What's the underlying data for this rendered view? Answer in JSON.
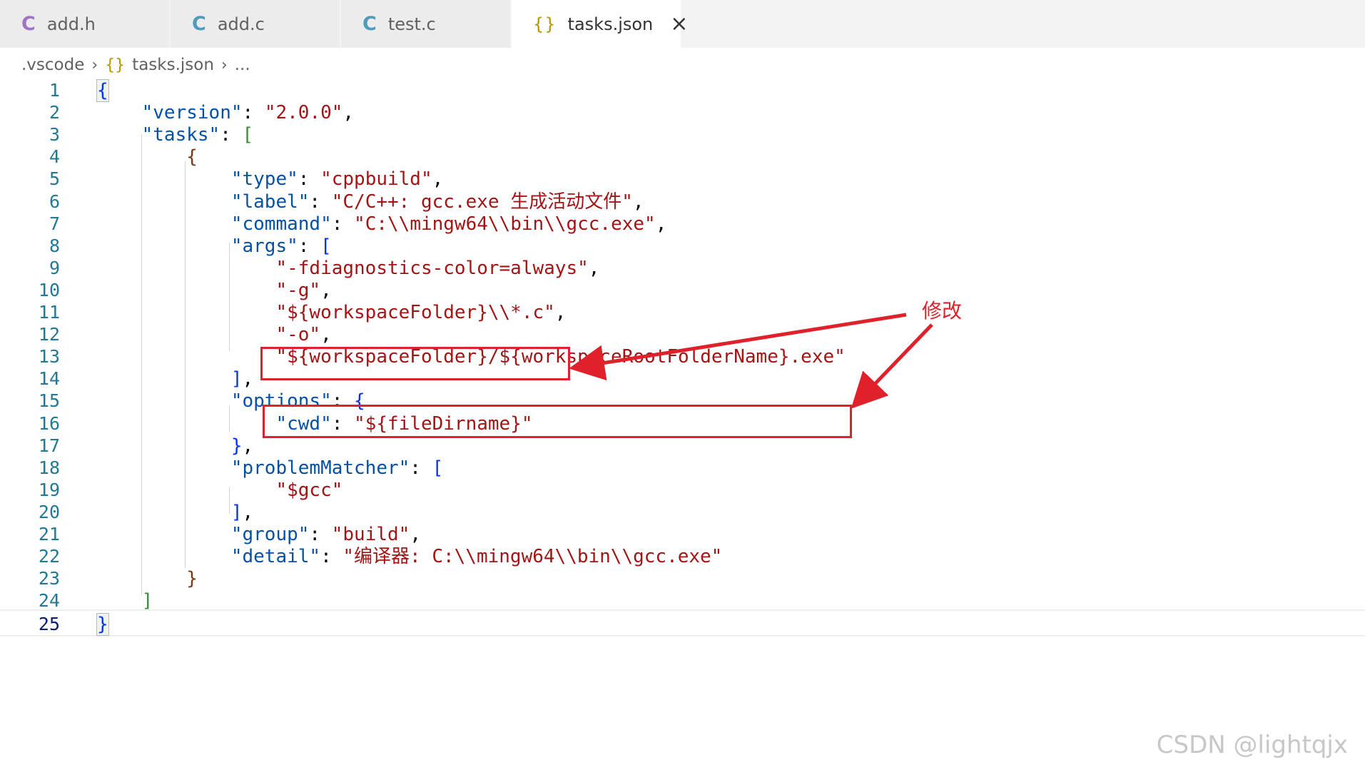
{
  "tabs": [
    {
      "label": "add.h",
      "icon": "C",
      "icon_color": "#a074c4"
    },
    {
      "label": "add.c",
      "icon": "C",
      "icon_color": "#519aba"
    },
    {
      "label": "test.c",
      "icon": "C",
      "icon_color": "#519aba"
    },
    {
      "label": "tasks.json",
      "icon": "{}",
      "icon_color": "#b89500",
      "active": true,
      "close": "×"
    }
  ],
  "breadcrumb": {
    "folder": ".vscode",
    "file_icon": "{}",
    "file": "tasks.json",
    "more": "..."
  },
  "editor": {
    "current_line": 25,
    "lines": [
      {
        "n": "1",
        "text": "{"
      },
      {
        "n": "2",
        "text": "    \"version\": \"2.0.0\","
      },
      {
        "n": "3",
        "text": "    \"tasks\": ["
      },
      {
        "n": "4",
        "text": "        {"
      },
      {
        "n": "5",
        "text": "            \"type\": \"cppbuild\","
      },
      {
        "n": "6",
        "text": "            \"label\": \"C/C++: gcc.exe 生成活动文件\","
      },
      {
        "n": "7",
        "text": "            \"command\": \"C:\\\\mingw64\\\\bin\\\\gcc.exe\","
      },
      {
        "n": "8",
        "text": "            \"args\": ["
      },
      {
        "n": "9",
        "text": "                \"-fdiagnostics-color=always\","
      },
      {
        "n": "10",
        "text": "                \"-g\","
      },
      {
        "n": "11",
        "text": "                \"${workspaceFolder}\\\\*.c\","
      },
      {
        "n": "12",
        "text": "                \"-o\","
      },
      {
        "n": "13",
        "text": "                \"${workspaceFolder}/${workspaceRootFolderName}.exe\""
      },
      {
        "n": "14",
        "text": "            ],"
      },
      {
        "n": "15",
        "text": "            \"options\": {"
      },
      {
        "n": "16",
        "text": "                \"cwd\": \"${fileDirname}\""
      },
      {
        "n": "17",
        "text": "            },"
      },
      {
        "n": "18",
        "text": "            \"problemMatcher\": ["
      },
      {
        "n": "19",
        "text": "                \"$gcc\""
      },
      {
        "n": "20",
        "text": "            ],"
      },
      {
        "n": "21",
        "text": "            \"group\": \"build\","
      },
      {
        "n": "22",
        "text": "            \"detail\": \"编译器: C:\\\\mingw64\\\\bin\\\\gcc.exe\""
      },
      {
        "n": "23",
        "text": "        }"
      },
      {
        "n": "24",
        "text": "    ]"
      },
      {
        "n": "25",
        "text": "}"
      }
    ]
  },
  "annotation": {
    "label": "修改",
    "color": "#e0202a"
  },
  "watermark": "CSDN @lightqjx",
  "colors": {
    "key": "#0451a5",
    "string": "#a31515",
    "line_number": "#237893",
    "bracket_level1": "#0431fa",
    "bracket_level2": "#319331",
    "bracket_level3": "#7b3814"
  }
}
